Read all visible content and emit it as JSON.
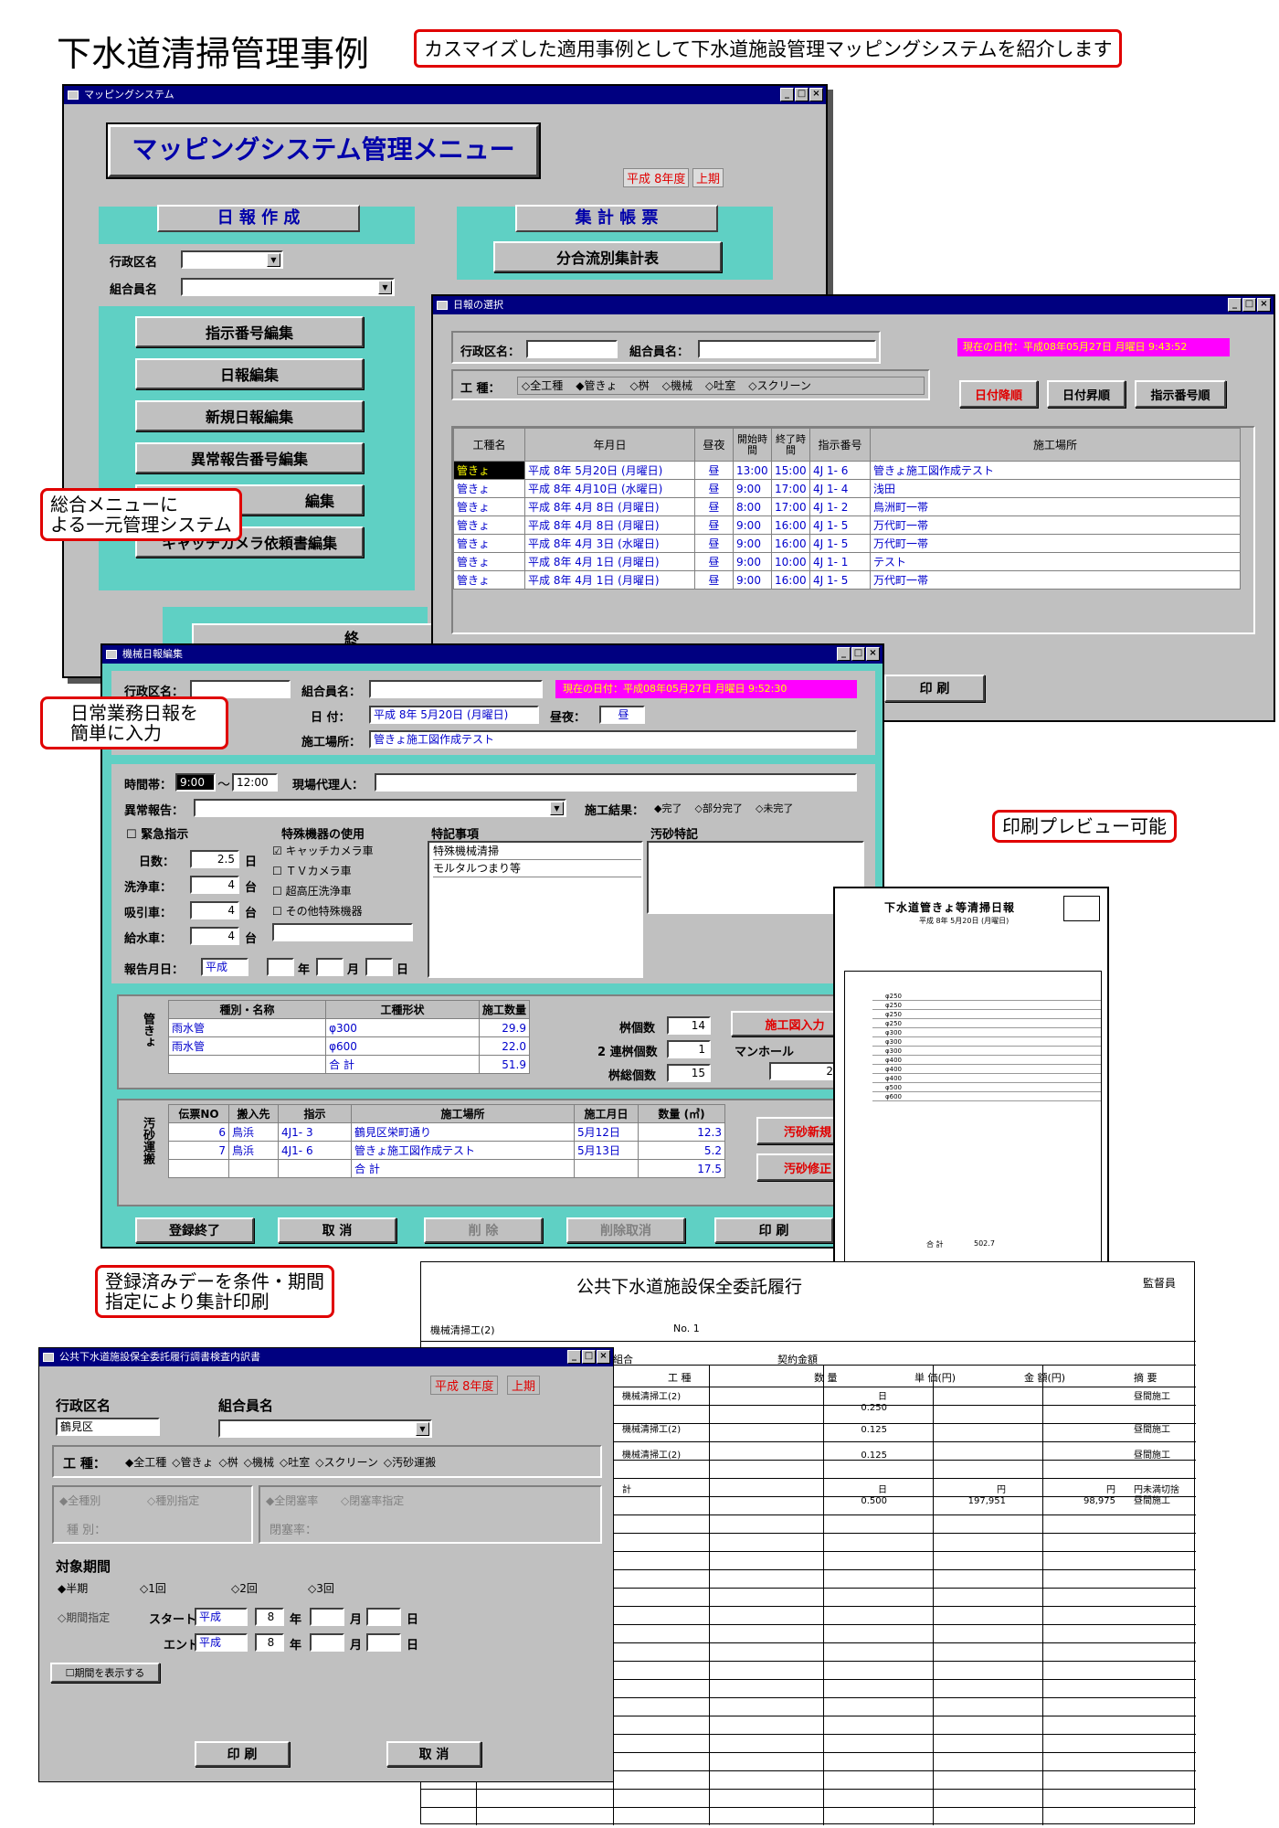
{
  "page": {
    "title": "下水道清掃管理事例",
    "subtitle": "カスマイズした適用事例として下水道施設管理マッピングシステムを紹介します"
  },
  "callouts": {
    "menu": "総合メニューに\nよる一元管理システム",
    "daily": "日常業務日報を\n簡単に入力",
    "preview": "印刷プレビュー可能",
    "summary": "登録済みデーを条件・期間\n指定により集計印刷"
  },
  "menu": {
    "window_title": "マッピングシステム",
    "heading": "マッピングシステム管理メニュー",
    "era": "平成 8年度",
    "half": "上期",
    "daily_section": "日 報 作 成",
    "summary_section": "集 計 帳 票",
    "ward_label": "行政区名",
    "member_label": "組合員名",
    "buttons": [
      "指示番号編集",
      "日報編集",
      "新規日報編集",
      "異常報告番号編集",
      "編集",
      "キャッチカメラ依頼書編集"
    ],
    "summary_button": "分合流別集計表",
    "exit_button": "終"
  },
  "select": {
    "window_title": "日報の選択",
    "ward_label": "行政区名：",
    "member_label": "組合員名：",
    "now": "現在の日付：平成08年05月27日 月曜日 9:43:52",
    "work_type_label": "工 種：",
    "types": [
      "全工種",
      "管きょ",
      "桝",
      "機械",
      "吐室",
      "スクリーン"
    ],
    "sort_buttons": [
      "日付降順",
      "日付昇順",
      "指示番号順"
    ],
    "columns": [
      "工種名",
      "年月日",
      "昼夜",
      "開始時間",
      "終了時間",
      "指示番号",
      "施工場所"
    ],
    "rows": [
      [
        "管きょ",
        "平成 8年 5月20日 (月曜日)",
        "昼",
        "13:00",
        "15:00",
        "4J 1- 6",
        "管きょ施工図作成テスト"
      ],
      [
        "管きょ",
        "平成 8年 4月10日 (水曜日)",
        "昼",
        "9:00",
        "17:00",
        "4J 1- 4",
        "浅田"
      ],
      [
        "管きょ",
        "平成 8年 4月 8日 (月曜日)",
        "昼",
        "8:00",
        "17:00",
        "4J 1- 2",
        "鳥洲町一帯"
      ],
      [
        "管きょ",
        "平成 8年 4月 8日 (月曜日)",
        "昼",
        "9:00",
        "16:00",
        "4J 1- 5",
        "万代町一帯"
      ],
      [
        "管きょ",
        "平成 8年 4月 3日 (水曜日)",
        "昼",
        "9:00",
        "16:00",
        "4J 1- 5",
        "万代町一帯"
      ],
      [
        "管きょ",
        "平成 8年 4月 1日 (月曜日)",
        "昼",
        "9:00",
        "10:00",
        "4J 1- 1",
        "テスト"
      ],
      [
        "管きょ",
        "平成 8年 4月 1日 (月曜日)",
        "昼",
        "9:00",
        "16:00",
        "4J 1- 5",
        "万代町一帯"
      ]
    ],
    "print_button": "印 刷"
  },
  "machine": {
    "window_title": "機械日報編集",
    "ward_label": "行政区名：",
    "member_label": "組合員名：",
    "now": "現在の日付：平成08年05月27日 月曜日 9:52:30",
    "date_label": "日 付：",
    "date": "平成 8年 5月20日 (月曜日)",
    "daynight_label": "昼夜：",
    "daynight": "昼",
    "site_label": "施工場所：",
    "site": "管きょ施工図作成テスト",
    "time_label": "時間帯：",
    "time_from": "9:00",
    "time_sep": "～",
    "time_to": "12:00",
    "agent_label": "現場代理人：",
    "abnormal_label": "異常報告：",
    "result_label": "施工結果：",
    "results": [
      "完了",
      "部分完了",
      "未完了"
    ],
    "emergency": "緊急指示",
    "special_equip": "特殊機器の使用",
    "equip": [
      "キャッチカメラ車",
      "ＴＶカメラ車",
      "超高圧洗浄車",
      "その他特殊機器"
    ],
    "notes_label": "特記事項",
    "notes": [
      "特殊機械清掃",
      "モルタルつまり等"
    ],
    "sludge_note": "汚砂特記",
    "days_label": "日数：",
    "days": "2.5",
    "days_unit": "日",
    "wash_label": "洗浄車：",
    "wash": "4",
    "suck_label": "吸引車：",
    "suck": "4",
    "water_label": "給水車：",
    "water": "4",
    "unit": "台",
    "report_label": "報告月日：",
    "report_era": "平成",
    "y": "年",
    "m": "月",
    "d": "日",
    "pipe_side": "管きょ",
    "pipe_cols": [
      "種別・名称",
      "工種形状",
      "施工数量"
    ],
    "pipe_rows": [
      [
        "雨水管",
        "φ300",
        "29.9"
      ],
      [
        "雨水管",
        "φ600",
        "22.0"
      ],
      [
        "",
        "合 計",
        "51.9"
      ]
    ],
    "basin_label": "桝個数",
    "basin": "14",
    "basin2_label": "2 連桝個数",
    "basin2": "1",
    "basin_total_label": "桝総個数",
    "basin_total": "15",
    "manhole_label": "マンホール",
    "manhole": "2",
    "drawing_button": "施工図入力",
    "sludge_side": "汚砂運搬",
    "sludge_cols": [
      "伝票NO",
      "搬入先",
      "指示",
      "施工場所",
      "施工月日",
      "数量 (㎥)"
    ],
    "sludge_rows": [
      [
        "6",
        "鳥浜",
        "4J1- 3",
        "鶴見区栄町通り",
        "5月12日",
        "12.3"
      ],
      [
        "7",
        "鳥浜",
        "4J1- 6",
        "管きょ施工図作成テスト",
        "5月13日",
        "5.2"
      ],
      [
        "",
        "",
        "",
        "合 計",
        "",
        "17.5"
      ]
    ],
    "sludge_new": "汚砂新規",
    "sludge_edit": "汚砂修正",
    "footer": [
      "登録終了",
      "取 消",
      "削 除",
      "削除取消",
      "印 刷"
    ]
  },
  "preview": {
    "title": "下水道管きょ等清掃日報",
    "date": "平成 8年 5月20日 (月曜日)",
    "rows": [
      "φ250",
      "φ250",
      "φ250",
      "φ250",
      "φ300",
      "φ300",
      "φ300",
      "φ400",
      "φ400",
      "φ400",
      "φ500",
      "φ600"
    ],
    "total": "合 計",
    "total_val": "502.7"
  },
  "report": {
    "title": "公共下水道施設保全委託履行",
    "sub": "機械清掃工(2)",
    "no": "No. 1",
    "member": "組合",
    "contract": "契約金額",
    "cols": [
      "工 種",
      "数 量",
      "単 価(円)",
      "金 額(円)",
      "摘 要"
    ],
    "rows": [
      [
        "機械清掃工(2)",
        "日\n0.250",
        "",
        "",
        "昼間施工"
      ],
      [
        "機械清掃工(2)",
        "0.125",
        "",
        "",
        "昼間施工"
      ],
      [
        "機械清掃工(2)",
        "0.125",
        "",
        "",
        "昼間施工"
      ],
      [
        "計",
        "日\n0.500",
        "円\n197,951",
        "円\n98,975",
        "円未満切捨\n昼間施工"
      ]
    ],
    "inspector": "監督員"
  },
  "summary": {
    "window_title": "公共下水道施設保全委託履行調書検査内訳書",
    "era": "平成 8年度",
    "half": "上期",
    "ward_label": "行政区名",
    "ward": "鶴見区",
    "member_label": "組合員名",
    "work_label": "工 種：",
    "types": [
      "全工種",
      "管きょ",
      "桝",
      "機械",
      "吐室",
      "スクリーン",
      "汚砂運搬"
    ],
    "all_kind": "全種別",
    "kind_spec": "種別指定",
    "kind_label": "種 別：",
    "all_close": "全閉塞率",
    "close_spec": "閉塞率指定",
    "close_label": "閉塞率：",
    "period_label": "対象期間",
    "periods": [
      "半期",
      "1回",
      "2回",
      "3回"
    ],
    "period_spec": "期間指定",
    "start": "スタート",
    "end": "エンド",
    "era_short": "平成",
    "year": "8",
    "y": "年",
    "m": "月",
    "d": "日",
    "show_period": "期間を表示する",
    "print": "印 刷",
    "cancel": "取 消"
  }
}
